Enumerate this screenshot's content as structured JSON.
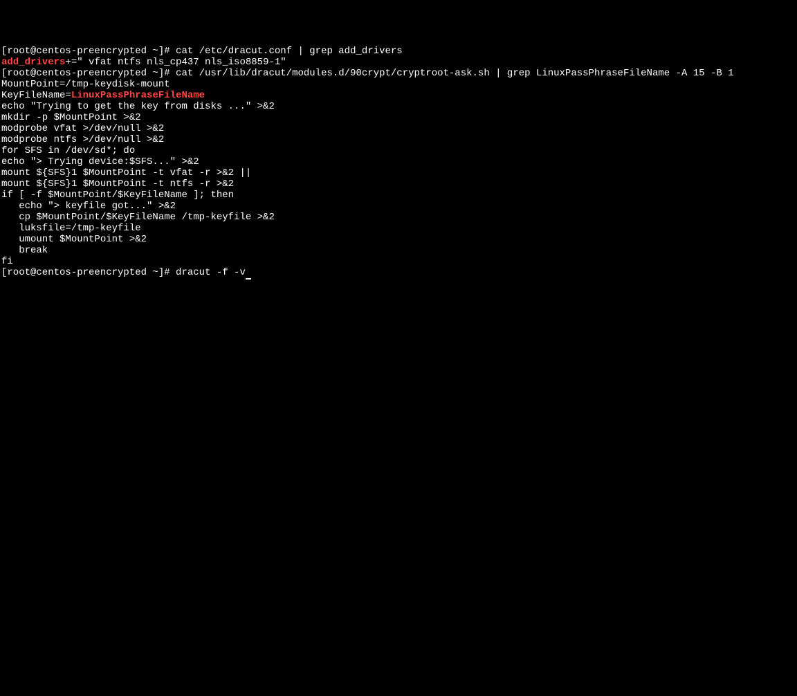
{
  "terminal": {
    "lines": [
      {
        "type": "plain",
        "text": "[root@centos-preencrypted ~]# cat /etc/dracut.conf | grep add_drivers"
      },
      {
        "type": "highlighted",
        "pre": "",
        "hl": "add_drivers",
        "post": "+=\" vfat ntfs nls_cp437 nls_iso8859-1\""
      },
      {
        "type": "plain",
        "text": "[root@centos-preencrypted ~]# cat /usr/lib/dracut/modules.d/90crypt/cryptroot-ask.sh | grep LinuxPassPhraseFileName -A 15 -B 1"
      },
      {
        "type": "plain",
        "text": "MountPoint=/tmp-keydisk-mount"
      },
      {
        "type": "highlighted",
        "pre": "KeyFileName=",
        "hl": "LinuxPassPhraseFileName",
        "post": ""
      },
      {
        "type": "plain",
        "text": "echo \"Trying to get the key from disks ...\" >&2"
      },
      {
        "type": "plain",
        "text": "mkdir -p $MountPoint >&2"
      },
      {
        "type": "plain",
        "text": "modprobe vfat >/dev/null >&2"
      },
      {
        "type": "plain",
        "text": "modprobe ntfs >/dev/null >&2"
      },
      {
        "type": "plain",
        "text": "for SFS in /dev/sd*; do"
      },
      {
        "type": "plain",
        "text": "echo \"> Trying device:$SFS...\" >&2"
      },
      {
        "type": "plain",
        "text": "mount ${SFS}1 $MountPoint -t vfat -r >&2 ||"
      },
      {
        "type": "plain",
        "text": "mount ${SFS}1 $MountPoint -t ntfs -r >&2"
      },
      {
        "type": "plain",
        "text": "if [ -f $MountPoint/$KeyFileName ]; then"
      },
      {
        "type": "plain",
        "text": "   echo \"> keyfile got...\" >&2"
      },
      {
        "type": "plain",
        "text": "   cp $MountPoint/$KeyFileName /tmp-keyfile >&2"
      },
      {
        "type": "plain",
        "text": "   luksfile=/tmp-keyfile"
      },
      {
        "type": "plain",
        "text": "   umount $MountPoint >&2"
      },
      {
        "type": "plain",
        "text": "   break"
      },
      {
        "type": "plain",
        "text": "fi"
      },
      {
        "type": "prompt",
        "text": "[root@centos-preencrypted ~]# dracut -f -v"
      }
    ]
  }
}
